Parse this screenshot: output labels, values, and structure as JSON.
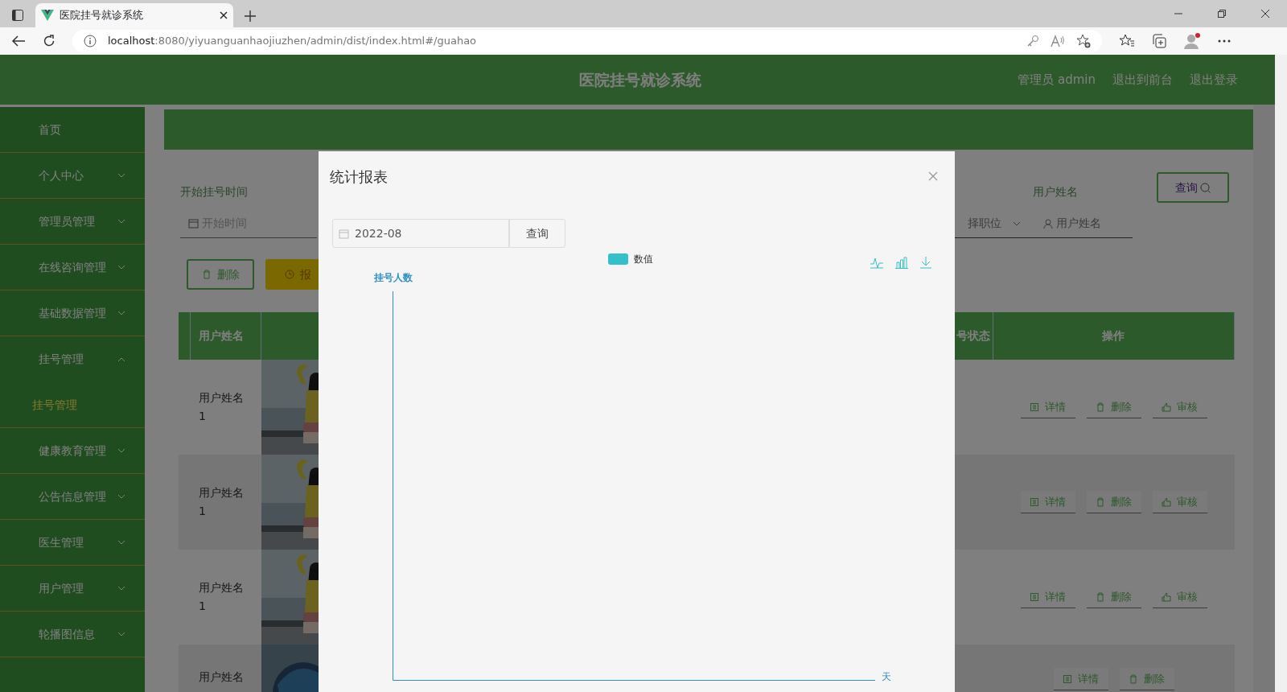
{
  "browser": {
    "tab_title": "医院挂号就诊系统",
    "url_host": "localhost",
    "url_path": ":8080/yiyuanguanhaojiuzhen/admin/dist/index.html#/guahao"
  },
  "header": {
    "title": "医院挂号就诊系统",
    "links": [
      "管理员 admin",
      "退出到前台",
      "退出登录"
    ]
  },
  "sidebar": {
    "items": [
      {
        "label": "首页",
        "kind": "link"
      },
      {
        "label": "个人中心",
        "kind": "menu",
        "expanded": false
      },
      {
        "label": "管理员管理",
        "kind": "menu",
        "expanded": false
      },
      {
        "label": "在线咨询管理",
        "kind": "menu",
        "expanded": false
      },
      {
        "label": "基础数据管理",
        "kind": "menu",
        "expanded": false
      },
      {
        "label": "挂号管理",
        "kind": "menu",
        "expanded": true,
        "children": [
          {
            "label": "挂号管理",
            "selected": true
          }
        ]
      },
      {
        "label": "健康教育管理",
        "kind": "menu",
        "expanded": false
      },
      {
        "label": "公告信息管理",
        "kind": "menu",
        "expanded": false
      },
      {
        "label": "医生管理",
        "kind": "menu",
        "expanded": false
      },
      {
        "label": "用户管理",
        "kind": "menu",
        "expanded": false
      },
      {
        "label": "轮播图信息",
        "kind": "menu",
        "expanded": false
      }
    ]
  },
  "search": {
    "labels": [
      "开始挂号时间",
      "用户姓名"
    ],
    "start_placeholder": "开始时间",
    "select_placeholder": "择职位",
    "name_placeholder": "用户姓名",
    "button": "查询"
  },
  "toolbar": [
    "删除",
    "报"
  ],
  "table": {
    "columns": [
      "用户姓名",
      "号状态",
      "操作"
    ],
    "rows": [
      {
        "name": "用户姓名1",
        "actions": [
          "详情",
          "删除",
          "审核"
        ]
      },
      {
        "name": "用户姓名1",
        "actions": [
          "详情",
          "删除",
          "审核"
        ]
      },
      {
        "name": "用户姓名1",
        "actions": [
          "详情",
          "删除",
          "审核"
        ]
      },
      {
        "name": "用户姓名",
        "actions": [
          "详情",
          "删除"
        ]
      }
    ]
  },
  "dialog": {
    "title": "统计报表",
    "date": "2022-08",
    "button": "查询",
    "legend": "数值",
    "y_axis_name": "挂号人数",
    "x_axis_name": "天"
  }
}
